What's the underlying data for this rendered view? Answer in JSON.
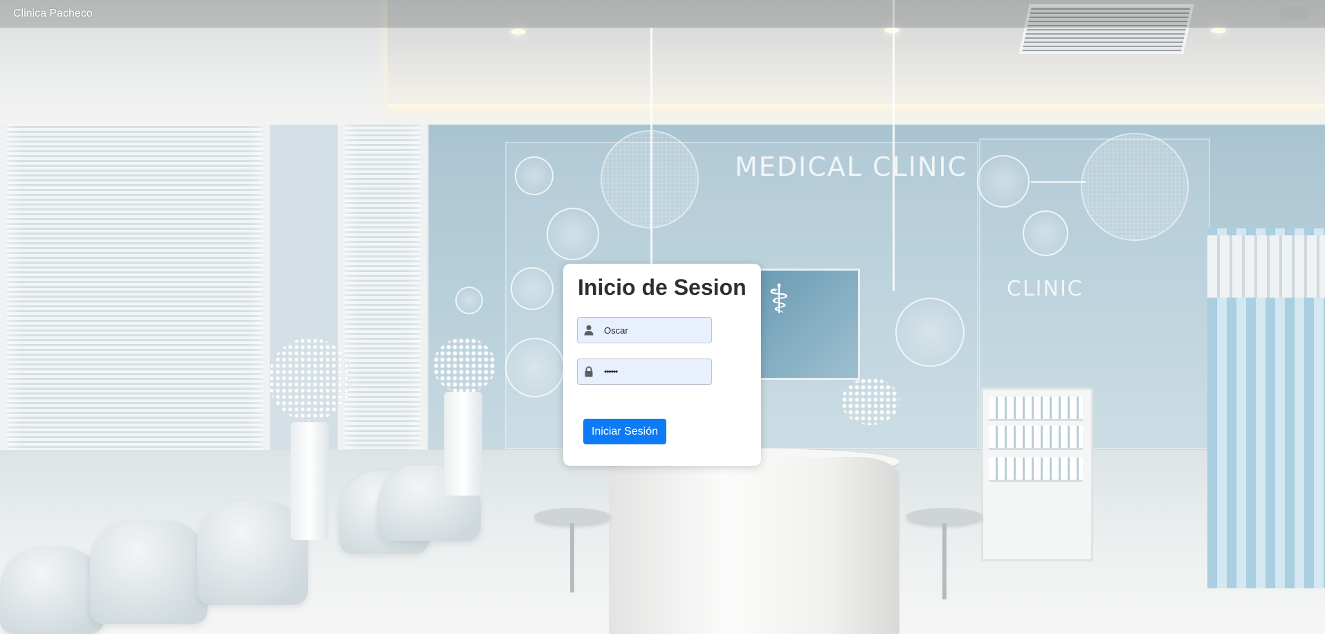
{
  "header": {
    "brand": "Clinica Pacheco"
  },
  "background": {
    "wall_sign_main": "MEDICAL CLINIC",
    "wall_sign_secondary": "CLINIC"
  },
  "login": {
    "title": "Inicio de Sesion",
    "username": {
      "icon": "user-icon",
      "value": "Oscar"
    },
    "password": {
      "icon": "lock-icon",
      "value": "••••••"
    },
    "submit_label": "Iniciar Sesión"
  },
  "colors": {
    "primary_button": "#0d7bf5",
    "autofill_field": "#e8f0fe",
    "card_background": "#ffffff"
  }
}
